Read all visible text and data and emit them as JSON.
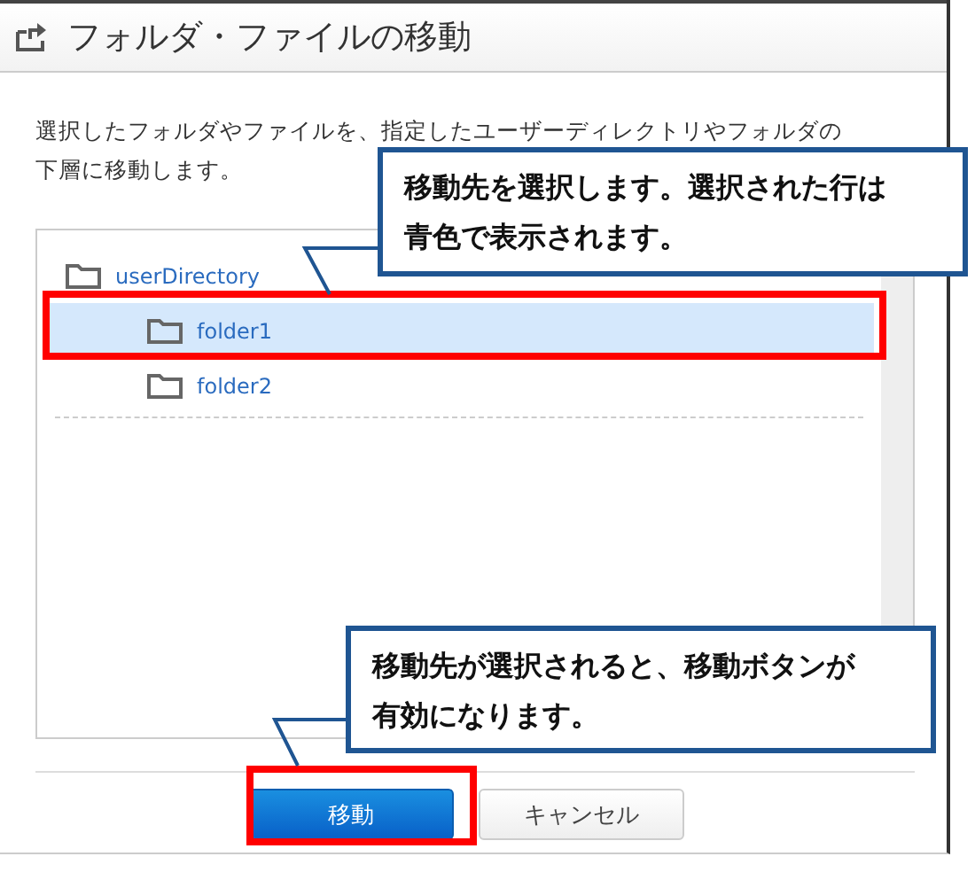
{
  "dialog": {
    "title": "フォルダ・ファイルの移動",
    "description_lines": [
      "選択したフォルダやファイルを、指定したユーザーディレクトリやフォルダの",
      "下層に移動します。"
    ]
  },
  "tree": [
    {
      "label": "userDirectory",
      "selected": false,
      "children": [
        {
          "label": "folder1",
          "selected": true
        },
        {
          "label": "folder2",
          "selected": false
        }
      ]
    }
  ],
  "buttons": [
    {
      "label": "移動",
      "kind": "primary"
    },
    {
      "label": "キャンセル",
      "kind": "secondary"
    }
  ],
  "callouts": [
    {
      "text": "移動先を選択します。選択された行は青色で表示されます。"
    },
    {
      "text": "移動先が選択されると、移動ボタンが有効になります。"
    }
  ]
}
